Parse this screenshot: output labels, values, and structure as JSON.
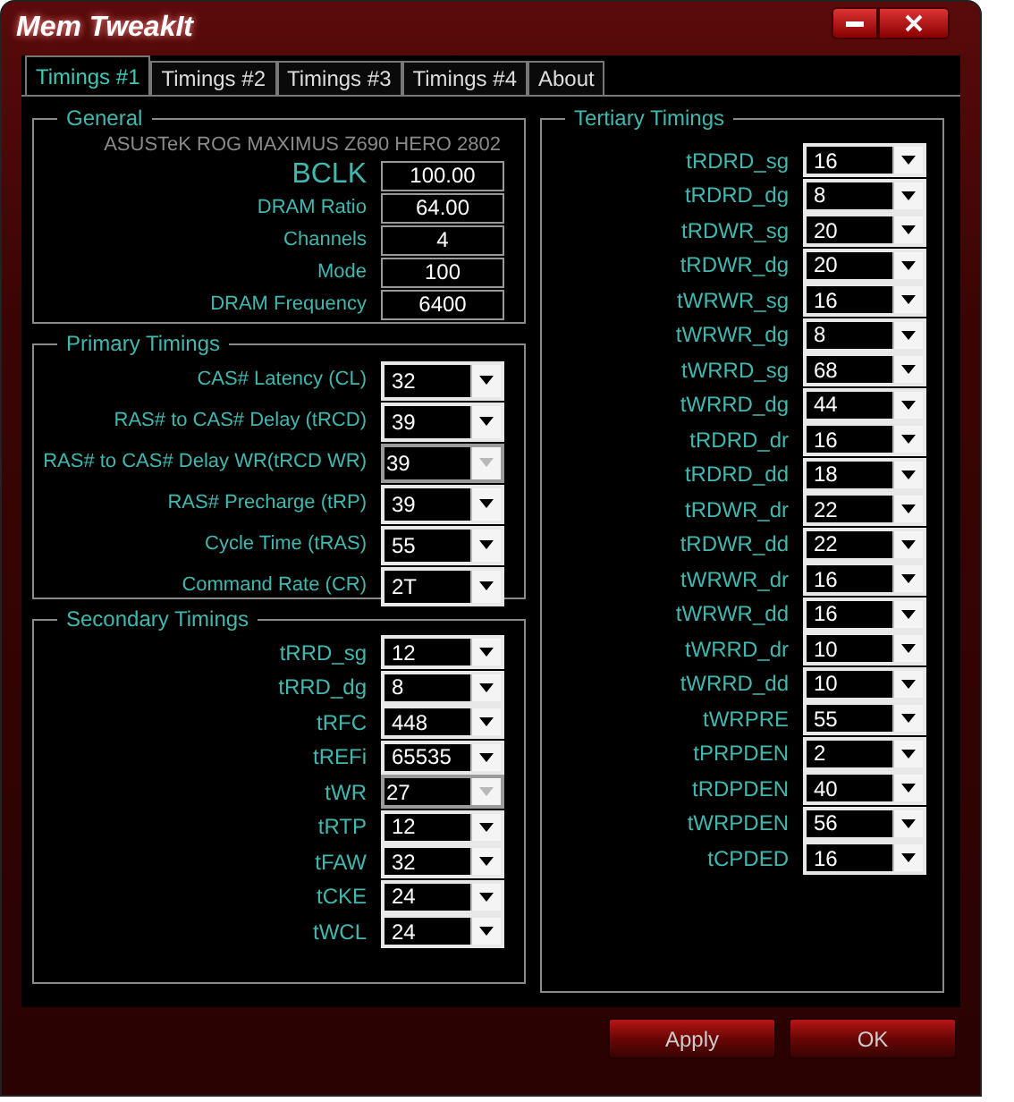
{
  "window": {
    "title": "Mem TweakIt"
  },
  "tabs": [
    {
      "label": "Timings #1",
      "selected": true
    },
    {
      "label": "Timings #2",
      "selected": false
    },
    {
      "label": "Timings #3",
      "selected": false
    },
    {
      "label": "Timings #4",
      "selected": false
    },
    {
      "label": "About",
      "selected": false
    }
  ],
  "general": {
    "title": "General",
    "board": "ASUSTeK ROG MAXIMUS Z690 HERO 2802",
    "fields": [
      {
        "label": "BCLK",
        "value": "100.00",
        "kind": "large"
      },
      {
        "label": "DRAM Ratio",
        "value": "64.00",
        "kind": "normal"
      },
      {
        "label": "Channels",
        "value": "4",
        "kind": "normal"
      },
      {
        "label": "Mode",
        "value": "100",
        "kind": "normal"
      },
      {
        "label": "DRAM Frequency",
        "value": "6400",
        "kind": "normal"
      }
    ]
  },
  "primary": {
    "title": "Primary Timings",
    "rows": [
      {
        "label": "CAS# Latency (CL)",
        "value": "32",
        "disabled": false
      },
      {
        "label": "RAS# to CAS# Delay (tRCD)",
        "value": "39",
        "disabled": false
      },
      {
        "label": "RAS# to CAS# Delay WR(tRCD WR)",
        "value": "39",
        "disabled": true
      },
      {
        "label": "RAS# Precharge (tRP)",
        "value": "39",
        "disabled": false
      },
      {
        "label": "Cycle Time (tRAS)",
        "value": "55",
        "disabled": false
      },
      {
        "label": "Command Rate (CR)",
        "value": "2T",
        "disabled": false
      }
    ]
  },
  "secondary": {
    "title": "Secondary Timings",
    "rows": [
      {
        "label": "tRRD_sg",
        "value": "12",
        "disabled": false
      },
      {
        "label": "tRRD_dg",
        "value": "8",
        "disabled": false
      },
      {
        "label": "tRFC",
        "value": "448",
        "disabled": false
      },
      {
        "label": "tREFi",
        "value": "65535",
        "disabled": false
      },
      {
        "label": "tWR",
        "value": "27",
        "disabled": true
      },
      {
        "label": "tRTP",
        "value": "12",
        "disabled": false
      },
      {
        "label": "tFAW",
        "value": "32",
        "disabled": false
      },
      {
        "label": "tCKE",
        "value": "24",
        "disabled": false
      },
      {
        "label": "tWCL",
        "value": "24",
        "disabled": false
      }
    ]
  },
  "tertiary": {
    "title": "Tertiary Timings",
    "rows": [
      {
        "label": "tRDRD_sg",
        "value": "16",
        "disabled": false
      },
      {
        "label": "tRDRD_dg",
        "value": "8",
        "disabled": false
      },
      {
        "label": "tRDWR_sg",
        "value": "20",
        "disabled": false
      },
      {
        "label": "tRDWR_dg",
        "value": "20",
        "disabled": false
      },
      {
        "label": "tWRWR_sg",
        "value": "16",
        "disabled": false
      },
      {
        "label": "tWRWR_dg",
        "value": "8",
        "disabled": false
      },
      {
        "label": "tWRRD_sg",
        "value": "68",
        "disabled": false
      },
      {
        "label": "tWRRD_dg",
        "value": "44",
        "disabled": false
      },
      {
        "label": "tRDRD_dr",
        "value": "16",
        "disabled": false
      },
      {
        "label": "tRDRD_dd",
        "value": "18",
        "disabled": false
      },
      {
        "label": "tRDWR_dr",
        "value": "22",
        "disabled": false
      },
      {
        "label": "tRDWR_dd",
        "value": "22",
        "disabled": false
      },
      {
        "label": "tWRWR_dr",
        "value": "16",
        "disabled": false
      },
      {
        "label": "tWRWR_dd",
        "value": "16",
        "disabled": false
      },
      {
        "label": "tWRRD_dr",
        "value": "10",
        "disabled": false
      },
      {
        "label": "tWRRD_dd",
        "value": "10",
        "disabled": false
      },
      {
        "label": "tWRPRE",
        "value": "55",
        "disabled": false
      },
      {
        "label": "tPRPDEN",
        "value": "2",
        "disabled": false
      },
      {
        "label": "tRDPDEN",
        "value": "40",
        "disabled": false
      },
      {
        "label": "tWRPDEN",
        "value": "56",
        "disabled": false
      },
      {
        "label": "tCPDED",
        "value": "16",
        "disabled": false
      }
    ]
  },
  "buttons": [
    "Apply",
    "OK"
  ]
}
